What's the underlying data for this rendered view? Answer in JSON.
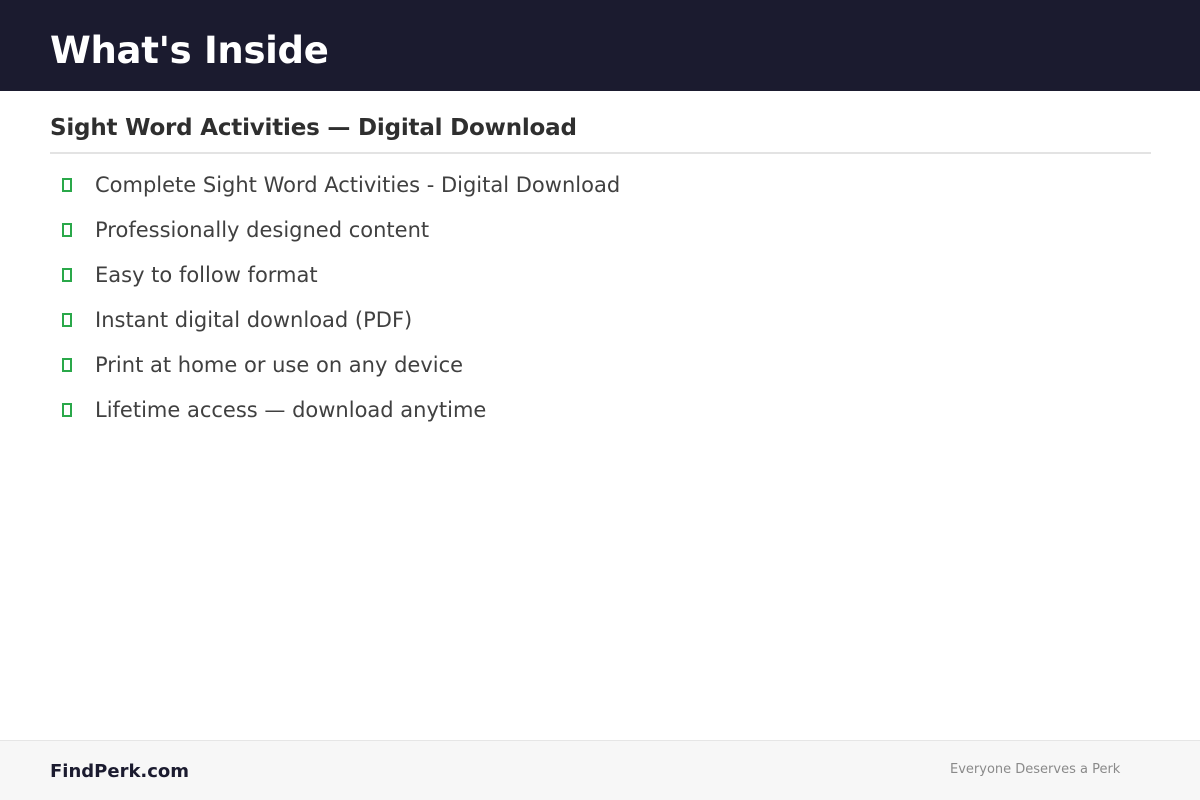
{
  "header": {
    "title": "What's Inside"
  },
  "section": {
    "heading": "Sight Word Activities — Digital Download",
    "items": [
      "Complete Sight Word Activities - Digital Download",
      "Professionally designed content",
      "Easy to follow format",
      "Instant digital download (PDF)",
      "Print at home or use on any device",
      "Lifetime access — download anytime"
    ],
    "item_icon": "checkbox-icon"
  },
  "footer": {
    "brand": "FindPerk.com",
    "tagline": "Everyone Deserves a Perk"
  },
  "colors": {
    "header_background": "#1b1b2f",
    "accent_check": "#2aa84a",
    "footer_background": "#f7f7f7"
  }
}
